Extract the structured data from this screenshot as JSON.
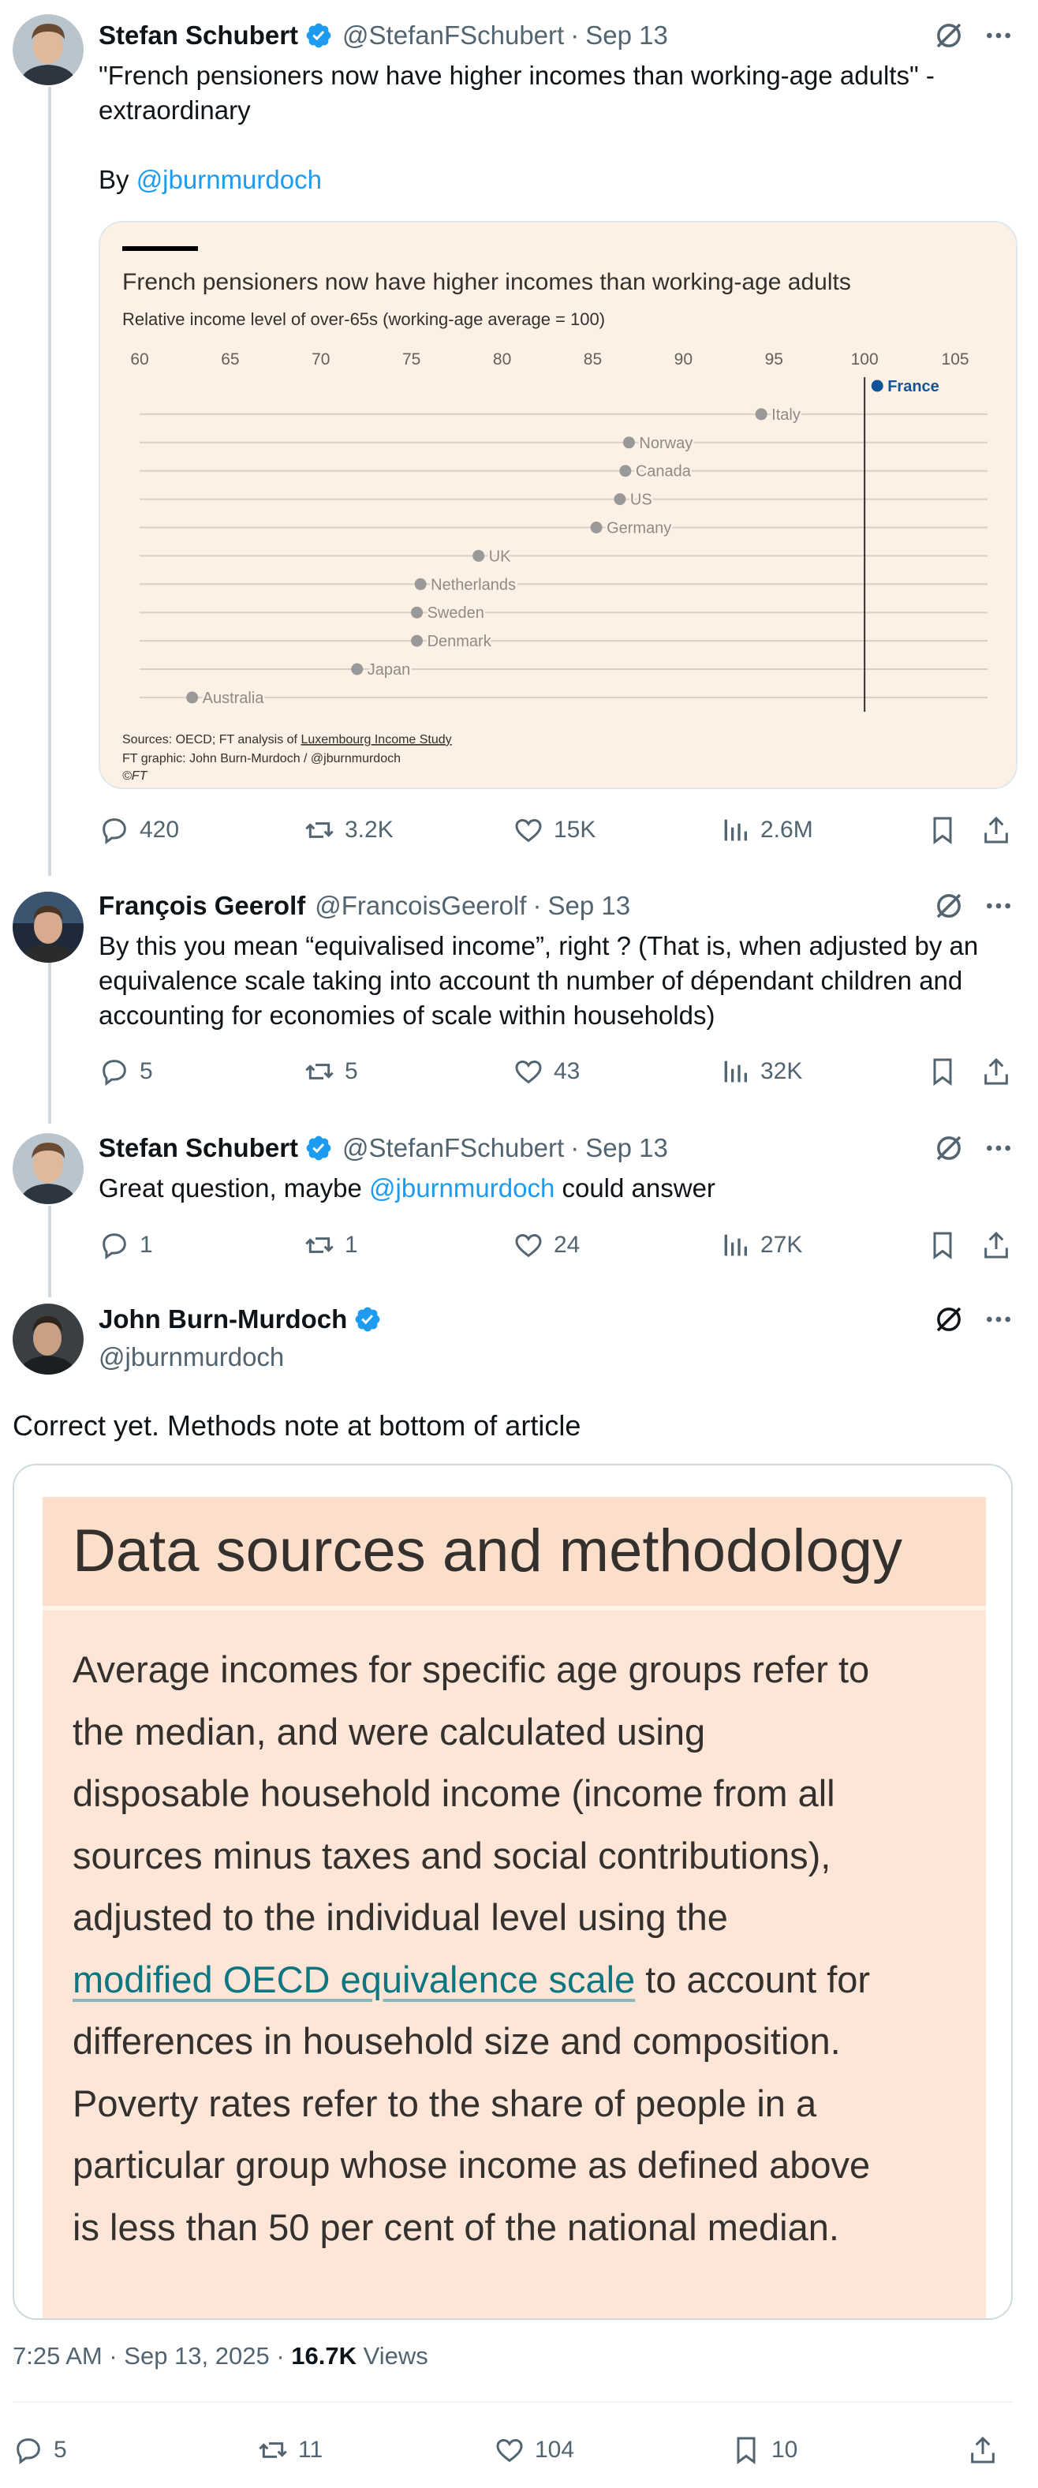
{
  "tweets": [
    {
      "name": "Stefan Schubert",
      "handle": "@StefanFSchubert",
      "time": "Sep 13",
      "text_line1": "\"French pensioners now have higher incomes than working-age adults\" -",
      "text_line2": "extraordinary",
      "by_label": "By ",
      "by_link": "@jburnmurdoch",
      "replies": "420",
      "reposts": "3.2K",
      "likes": "15K",
      "views": "2.6M"
    },
    {
      "name": "François Geerolf",
      "handle": "@FrancoisGeerolf",
      "time": "Sep 13",
      "text_line1": "By this you mean “equivalised income”, right ? (That is, when adjusted by an",
      "text_line2": "equivalence scale taking into account th number of dépendant children and",
      "text_line3": "accounting for economies of scale within households)",
      "replies": "5",
      "reposts": "5",
      "likes": "43",
      "views": "32K"
    },
    {
      "name": "Stefan Schubert",
      "handle": "@StefanFSchubert",
      "time": "Sep 13",
      "text_prefix": "Great question, maybe ",
      "text_link": "@jburnmurdoch",
      "text_suffix": " could answer",
      "replies": "1",
      "reposts": "1",
      "likes": "24",
      "views": "27K"
    }
  ],
  "main_tweet": {
    "name": "John Burn-Murdoch",
    "handle": "@jburnmurdoch",
    "text": "Correct yet. Methods note at bottom of article",
    "meta_time": "7:25 AM · Sep 13, 2025 · ",
    "meta_views_count": "16.7K",
    "meta_views_label": " Views",
    "replies": "5",
    "reposts": "11",
    "likes": "104",
    "bookmarks": "10"
  },
  "methodology": {
    "title": "Data sources and methodology",
    "lines": [
      "Average incomes for specific age groups refer to",
      "the median, and were calculated using",
      "disposable household income (income from all",
      "sources minus taxes and social contributions),",
      "adjusted to the individual level using the"
    ],
    "link_text": "modified OECD equivalence scale",
    "link_suffix": " to account for",
    "lines_after": [
      "differences in household size and composition.",
      "Poverty rates refer to the share of people in a",
      "particular group whose income as defined above",
      "is less than 50 per cent of the national median."
    ]
  },
  "chart_data": {
    "type": "scatter",
    "title": "French pensioners now have higher incomes than working-age adults",
    "subtitle": "Relative income level of over-65s (working-age average = 100)",
    "xlim": [
      60,
      107
    ],
    "xticks": [
      60,
      65,
      70,
      75,
      80,
      85,
      90,
      95,
      100,
      105
    ],
    "reference_line": 100,
    "points": [
      {
        "country": "France",
        "value": 100.7,
        "highlight": true
      },
      {
        "country": "Italy",
        "value": 94.3
      },
      {
        "country": "Norway",
        "value": 87.0
      },
      {
        "country": "Canada",
        "value": 86.8
      },
      {
        "country": "US",
        "value": 86.5
      },
      {
        "country": "Germany",
        "value": 85.2
      },
      {
        "country": "UK",
        "value": 78.7
      },
      {
        "country": "Netherlands",
        "value": 75.5
      },
      {
        "country": "Sweden",
        "value": 75.3
      },
      {
        "country": "Denmark",
        "value": 75.3
      },
      {
        "country": "Japan",
        "value": 72.0
      },
      {
        "country": "Australia",
        "value": 62.9
      }
    ],
    "source_prefix": "Sources: OECD; FT analysis of ",
    "source_link": "Luxembourg Income Study",
    "credit": "FT graphic: John Burn-Murdoch / @jburnmurdoch",
    "copyright": "©FT",
    "colors": {
      "background": "#fdf1e5",
      "point": "#999999",
      "highlight": "#0f5499",
      "line": "#d9d0c7"
    }
  }
}
